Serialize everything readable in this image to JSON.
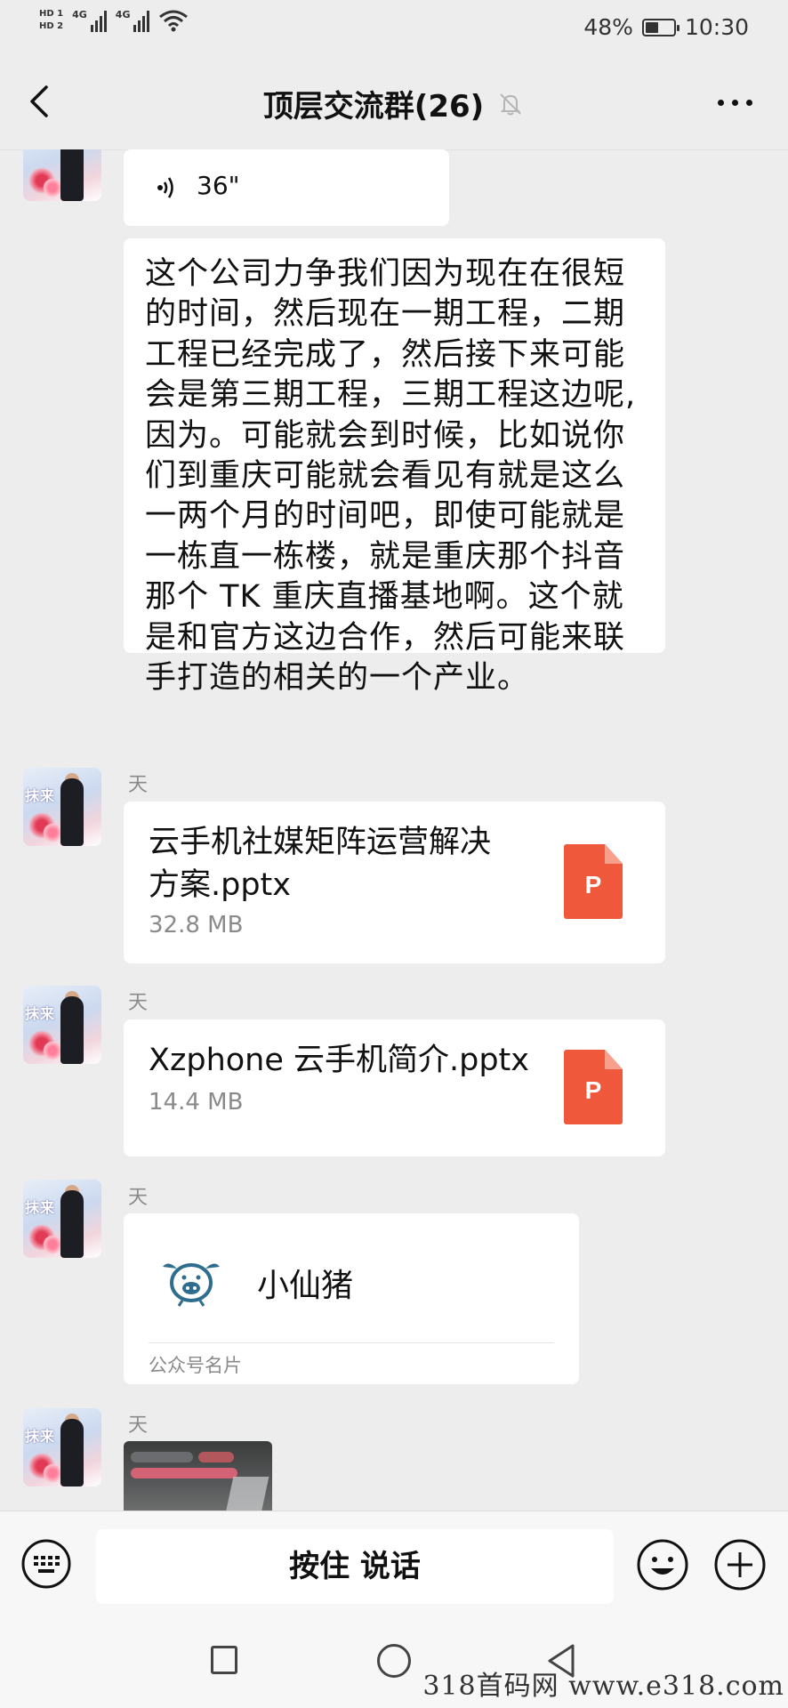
{
  "status_bar": {
    "hd1": "HD 1",
    "hd2": "HD 2",
    "net1": "4G",
    "net2": "4G",
    "battery_percent": "48%",
    "battery_level": 0.48,
    "time": "10:30"
  },
  "header": {
    "title": "顶层交流群(26)"
  },
  "messages": {
    "voice": {
      "duration": "36\""
    },
    "long_text": {
      "lines": [
        "这个公司力争我们因为现在在很短",
        "的时间，然后现在一期工程，二期",
        "工程已经完成了，然后接下来可能",
        "会是第三期工程，三期工程这边呢,",
        "因为。可能就会到时候，比如说你",
        "们到重庆可能就会看见有就是这么",
        "一两个月的时间吧，即使可能就是",
        "一栋直一栋楼，就是重庆那个抖音",
        "那个 TK 重庆直播基地啊。这个就",
        "是和官方这边合作，然后可能来联",
        "手打造的相关的一个产业。"
      ]
    },
    "file1": {
      "sender": "天",
      "name_line1": "云手机社媒矩阵运营解决",
      "name_line2": "方案.pptx",
      "size": "32.8 MB",
      "icon_letter": "P"
    },
    "file2": {
      "sender": "天",
      "name": "Xzphone 云手机简介.pptx",
      "size": "14.4 MB",
      "icon_letter": "P"
    },
    "card": {
      "sender": "天",
      "name": "小仙猪",
      "type": "公众号名片"
    },
    "image": {
      "sender": "天"
    }
  },
  "input_bar": {
    "talk_label": "按住 说话"
  },
  "watermark": "318首码网 www.e318.com",
  "colors": {
    "background": "#ededed",
    "bubble": "#ffffff",
    "ppt": "#f0583b"
  },
  "icons": [
    "back-icon",
    "mute-icon",
    "more-icon",
    "voice-wave-icon",
    "ppt-file-icon",
    "pig-logo-icon",
    "keyboard-icon",
    "emoji-icon",
    "plus-icon"
  ]
}
